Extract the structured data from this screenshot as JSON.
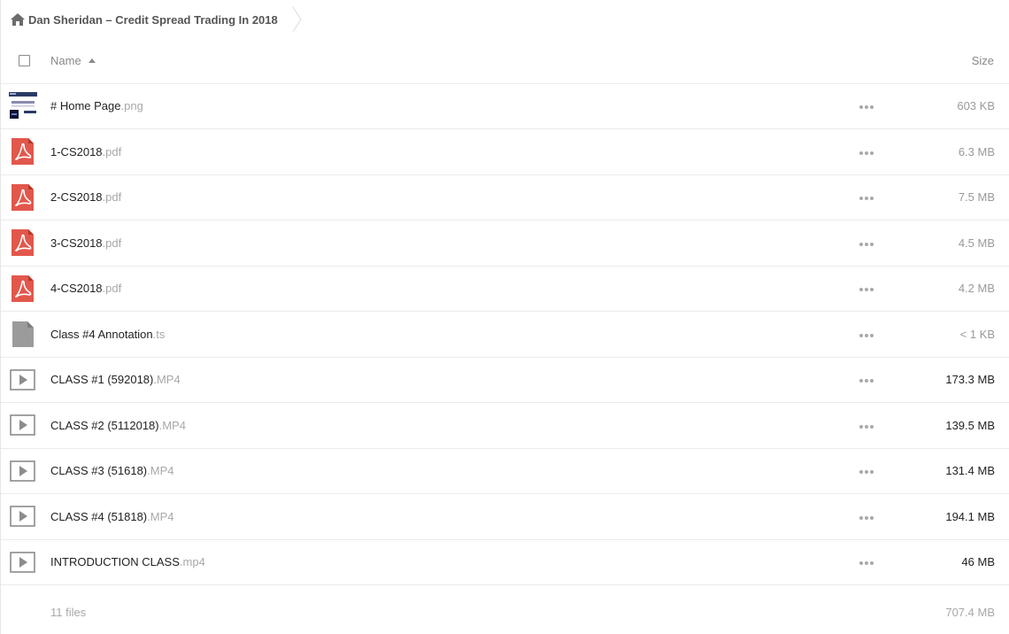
{
  "breadcrumb": {
    "folder_title": "Dan Sheridan – Credit Spread Trading In 2018"
  },
  "header": {
    "name_label": "Name",
    "size_label": "Size"
  },
  "files": [
    {
      "name": "# Home Page",
      "ext": ".png",
      "size": "603 KB",
      "icon": "image-thumbnail-icon",
      "size_style": "light"
    },
    {
      "name": "1-CS2018",
      "ext": ".pdf",
      "size": "6.3 MB",
      "icon": "pdf-icon",
      "size_style": "light"
    },
    {
      "name": "2-CS2018",
      "ext": ".pdf",
      "size": "7.5 MB",
      "icon": "pdf-icon",
      "size_style": "light"
    },
    {
      "name": "3-CS2018",
      "ext": ".pdf",
      "size": "4.5 MB",
      "icon": "pdf-icon",
      "size_style": "light"
    },
    {
      "name": "4-CS2018",
      "ext": ".pdf",
      "size": "4.2 MB",
      "icon": "pdf-icon",
      "size_style": "light"
    },
    {
      "name": "Class #4 Annotation",
      "ext": ".ts",
      "size": "< 1 KB",
      "icon": "generic-file-icon",
      "size_style": "light"
    },
    {
      "name": "CLASS #1 (592018)",
      "ext": ".MP4",
      "size": "173.3 MB",
      "icon": "video-play-icon",
      "size_style": "dark"
    },
    {
      "name": "CLASS #2 (5112018)",
      "ext": ".MP4",
      "size": "139.5 MB",
      "icon": "video-play-icon",
      "size_style": "dark"
    },
    {
      "name": "CLASS #3 (51618)",
      "ext": ".MP4",
      "size": "131.4 MB",
      "icon": "video-play-icon",
      "size_style": "dark"
    },
    {
      "name": "CLASS #4 (51818)",
      "ext": ".MP4",
      "size": "194.1 MB",
      "icon": "video-play-icon",
      "size_style": "dark"
    },
    {
      "name": "INTRODUCTION CLASS",
      "ext": ".mp4",
      "size": "46 MB",
      "icon": "video-play-icon",
      "size_style": "dark"
    }
  ],
  "footer": {
    "count_label": "11 files",
    "total_size": "707.4 MB"
  },
  "colors": {
    "pdf_red": "#e2574c",
    "generic_gray": "#9b9b9b",
    "video_border": "#8c8c8c",
    "extension_gray": "#a8a8a8"
  }
}
